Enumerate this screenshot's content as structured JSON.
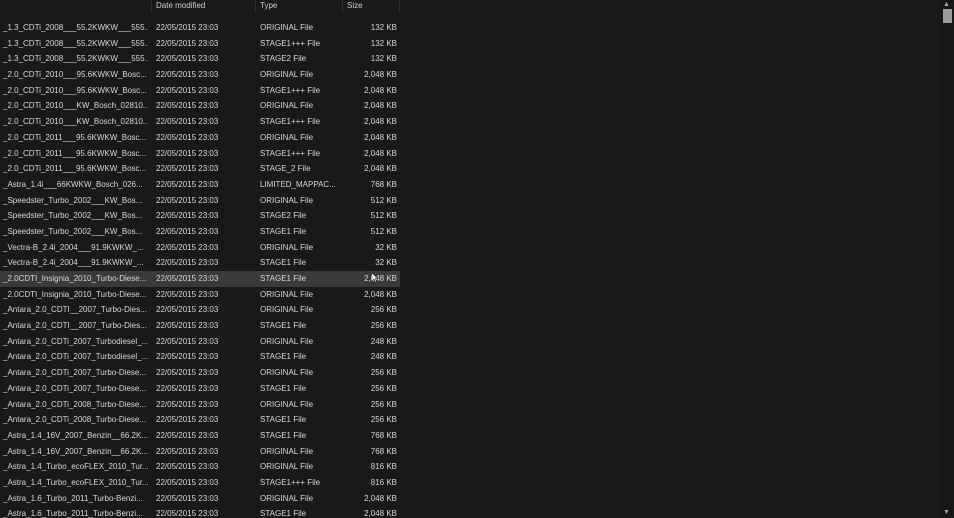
{
  "columns": {
    "date_modified": "Date modified",
    "type": "Type",
    "size": "Size"
  },
  "rows": [
    {
      "name": "_1.3_CDTi_2008___55.2KWKW___555...",
      "date": "22/05/2015 23:03",
      "type": "ORIGINAL File",
      "size": "132 KB"
    },
    {
      "name": "_1.3_CDTi_2008___55.2KWKW___555...",
      "date": "22/05/2015 23:03",
      "type": "STAGE1+++ File",
      "size": "132 KB"
    },
    {
      "name": "_1.3_CDTi_2008___55.2KWKW___555...",
      "date": "22/05/2015 23:03",
      "type": "STAGE2 File",
      "size": "132 KB"
    },
    {
      "name": "_2.0_CDTi_2010___95.6KWKW_Bosc...",
      "date": "22/05/2015 23:03",
      "type": "ORIGINAL File",
      "size": "2,048 KB"
    },
    {
      "name": "_2.0_CDTi_2010___95.6KWKW_Bosc...",
      "date": "22/05/2015 23:03",
      "type": "STAGE1+++ File",
      "size": "2,048 KB"
    },
    {
      "name": "_2.0_CDTi_2010___KW_Bosch_02810...",
      "date": "22/05/2015 23:03",
      "type": "ORIGINAL File",
      "size": "2,048 KB"
    },
    {
      "name": "_2.0_CDTi_2010___KW_Bosch_02810...",
      "date": "22/05/2015 23:03",
      "type": "STAGE1+++ File",
      "size": "2,048 KB"
    },
    {
      "name": "_2.0_CDTi_2011___95.6KWKW_Bosc...",
      "date": "22/05/2015 23:03",
      "type": "ORIGINAL File",
      "size": "2,048 KB"
    },
    {
      "name": "_2.0_CDTi_2011___95.6KWKW_Bosc...",
      "date": "22/05/2015 23:03",
      "type": "STAGE1+++ File",
      "size": "2,048 KB"
    },
    {
      "name": "_2.0_CDTi_2011___95.6KWKW_Bosc...",
      "date": "22/05/2015 23:03",
      "type": "STAGE_2 File",
      "size": "2,048 KB"
    },
    {
      "name": "_Astra_1.4i___66KWKW_Bosch_026...",
      "date": "22/05/2015 23:03",
      "type": "LIMITED_MAPPAC...",
      "size": "768 KB"
    },
    {
      "name": "_Speedster_Turbo_2002___KW_Bos...",
      "date": "22/05/2015 23:03",
      "type": "ORIGINAL File",
      "size": "512 KB"
    },
    {
      "name": "_Speedster_Turbo_2002___KW_Bos...",
      "date": "22/05/2015 23:03",
      "type": "STAGE2 File",
      "size": "512 KB"
    },
    {
      "name": "_Speedster_Turbo_2002___KW_Bos...",
      "date": "22/05/2015 23:03",
      "type": "STAGE1 File",
      "size": "512 KB"
    },
    {
      "name": "_Vectra-B_2.4i_2004___91.9KWKW_...",
      "date": "22/05/2015 23:03",
      "type": "ORIGINAL File",
      "size": "32 KB"
    },
    {
      "name": "_Vectra-B_2.4i_2004___91.9KWKW_...",
      "date": "22/05/2015 23:03",
      "type": "STAGE1 File",
      "size": "32 KB"
    },
    {
      "name": "_2.0CDTI_Insignia_2010_Turbo-Diese...",
      "date": "22/05/2015 23:03",
      "type": "STAGE1 File",
      "size": "2,048 KB"
    },
    {
      "name": "_2.0CDTI_Insignia_2010_Turbo-Diese...",
      "date": "22/05/2015 23:03",
      "type": "ORIGINAL File",
      "size": "2,048 KB"
    },
    {
      "name": "_Antara_2.0_CDTI__2007_Turbo-Dies...",
      "date": "22/05/2015 23:03",
      "type": "ORIGINAL File",
      "size": "256 KB"
    },
    {
      "name": "_Antara_2.0_CDTI__2007_Turbo-Dies...",
      "date": "22/05/2015 23:03",
      "type": "STAGE1 File",
      "size": "256 KB"
    },
    {
      "name": "_Antara_2.0_CDTi_2007_Turbodiesel_...",
      "date": "22/05/2015 23:03",
      "type": "ORIGINAL File",
      "size": "248 KB"
    },
    {
      "name": "_Antara_2.0_CDTi_2007_Turbodiesel_...",
      "date": "22/05/2015 23:03",
      "type": "STAGE1 File",
      "size": "248 KB"
    },
    {
      "name": "_Antara_2.0_CDTi_2007_Turbo-Diese...",
      "date": "22/05/2015 23:03",
      "type": "ORIGINAL File",
      "size": "256 KB"
    },
    {
      "name": "_Antara_2.0_CDTi_2007_Turbo-Diese...",
      "date": "22/05/2015 23:03",
      "type": "STAGE1 File",
      "size": "256 KB"
    },
    {
      "name": "_Antara_2.0_CDTi_2008_Turbo-Diese...",
      "date": "22/05/2015 23:03",
      "type": "ORIGINAL File",
      "size": "256 KB"
    },
    {
      "name": "_Antara_2.0_CDTi_2008_Turbo-Diese...",
      "date": "22/05/2015 23:03",
      "type": "STAGE1 File",
      "size": "256 KB"
    },
    {
      "name": "_Astra_1.4_16V_2007_Benzin__66.2K...",
      "date": "22/05/2015 23:03",
      "type": "STAGE1 File",
      "size": "768 KB"
    },
    {
      "name": "_Astra_1.4_16V_2007_Benzin__66.2K...",
      "date": "22/05/2015 23:03",
      "type": "ORIGINAL File",
      "size": "768 KB"
    },
    {
      "name": "_Astra_1.4_Turbo_ecoFLEX_2010_Tur...",
      "date": "22/05/2015 23:03",
      "type": "ORIGINAL File",
      "size": "816 KB"
    },
    {
      "name": "_Astra_1.4_Turbo_ecoFLEX_2010_Tur...",
      "date": "22/05/2015 23:03",
      "type": "STAGE1+++ File",
      "size": "816 KB"
    },
    {
      "name": "_Astra_1.6_Turbo_2011_Turbo-Benzi...",
      "date": "22/05/2015 23:03",
      "type": "ORIGINAL File",
      "size": "2,048 KB"
    },
    {
      "name": "_Astra_1.6_Turbo_2011_Turbo-Benzi...",
      "date": "22/05/2015 23:03",
      "type": "STAGE1 File",
      "size": "2,048 KB"
    }
  ],
  "selected_index": 16,
  "scrollbar": {
    "up_icon": "scroll-up-arrow",
    "down_icon": "scroll-down-arrow"
  },
  "colors": {
    "background": "#191919",
    "selected_row": "#3a3a3a",
    "text": "#d8d8d8"
  }
}
